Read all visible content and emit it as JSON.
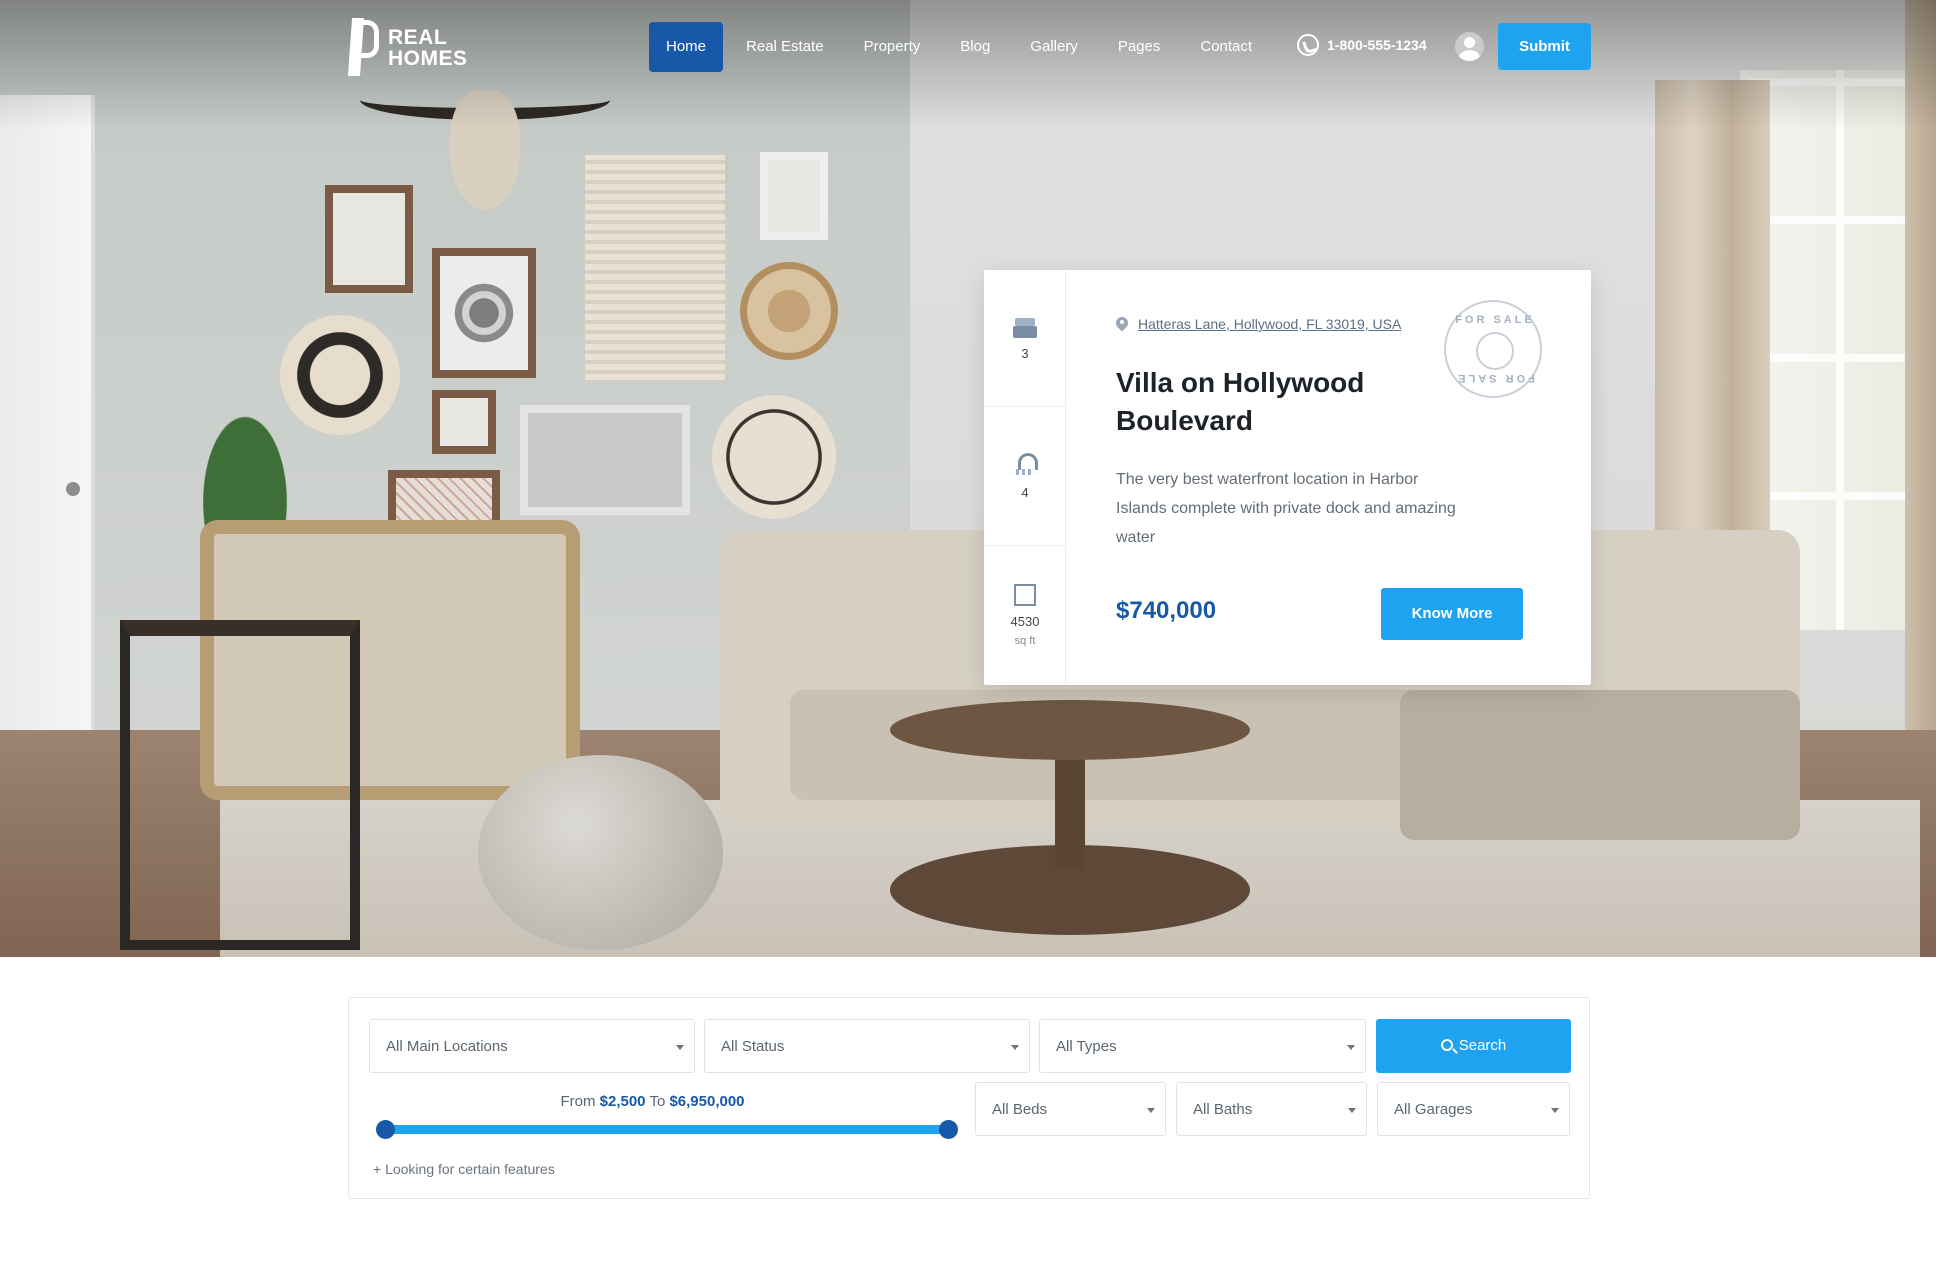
{
  "header": {
    "logo_line1": "REAL",
    "logo_line2": "HOMES",
    "nav": [
      "Home",
      "Real Estate",
      "Property",
      "Blog",
      "Gallery",
      "Pages",
      "Contact"
    ],
    "phone": "1-800-555-1234",
    "submit_label": "Submit"
  },
  "property_card": {
    "stats": {
      "beds": "3",
      "baths": "4",
      "area": "4530",
      "area_unit": "sq ft"
    },
    "address": "Hatteras Lane, Hollywood, FL 33019, USA",
    "title": "Villa on Hollywood Boulevard",
    "description": "The very best waterfront location in Harbor Islands complete with private dock and amazing water",
    "price": "$740,000",
    "cta_label": "Know More",
    "stamp_top": "FOR SALE",
    "stamp_bottom": "FOR SALE"
  },
  "search": {
    "location_select": "All Main Locations",
    "status_select": "All Status",
    "type_select": "All Types",
    "search_label": "Search",
    "price_from_label": "From",
    "price_from": "$2,500",
    "price_to_label": "To",
    "price_to": "$6,950,000",
    "beds_select": "All Beds",
    "baths_select": "All Baths",
    "garages_select": "All Garages",
    "features_link": "+ Looking for certain features"
  },
  "colors": {
    "primary_blue": "#1758a8",
    "accent_blue": "#1ea3f1",
    "text_dark": "#1d2329",
    "text_muted": "#646d77"
  },
  "icons": [
    "whatsapp-phone-icon",
    "user-icon",
    "bed-icon",
    "bath-icon",
    "area-icon",
    "map-pin-icon",
    "search-icon",
    "chevron-down-icon"
  ]
}
